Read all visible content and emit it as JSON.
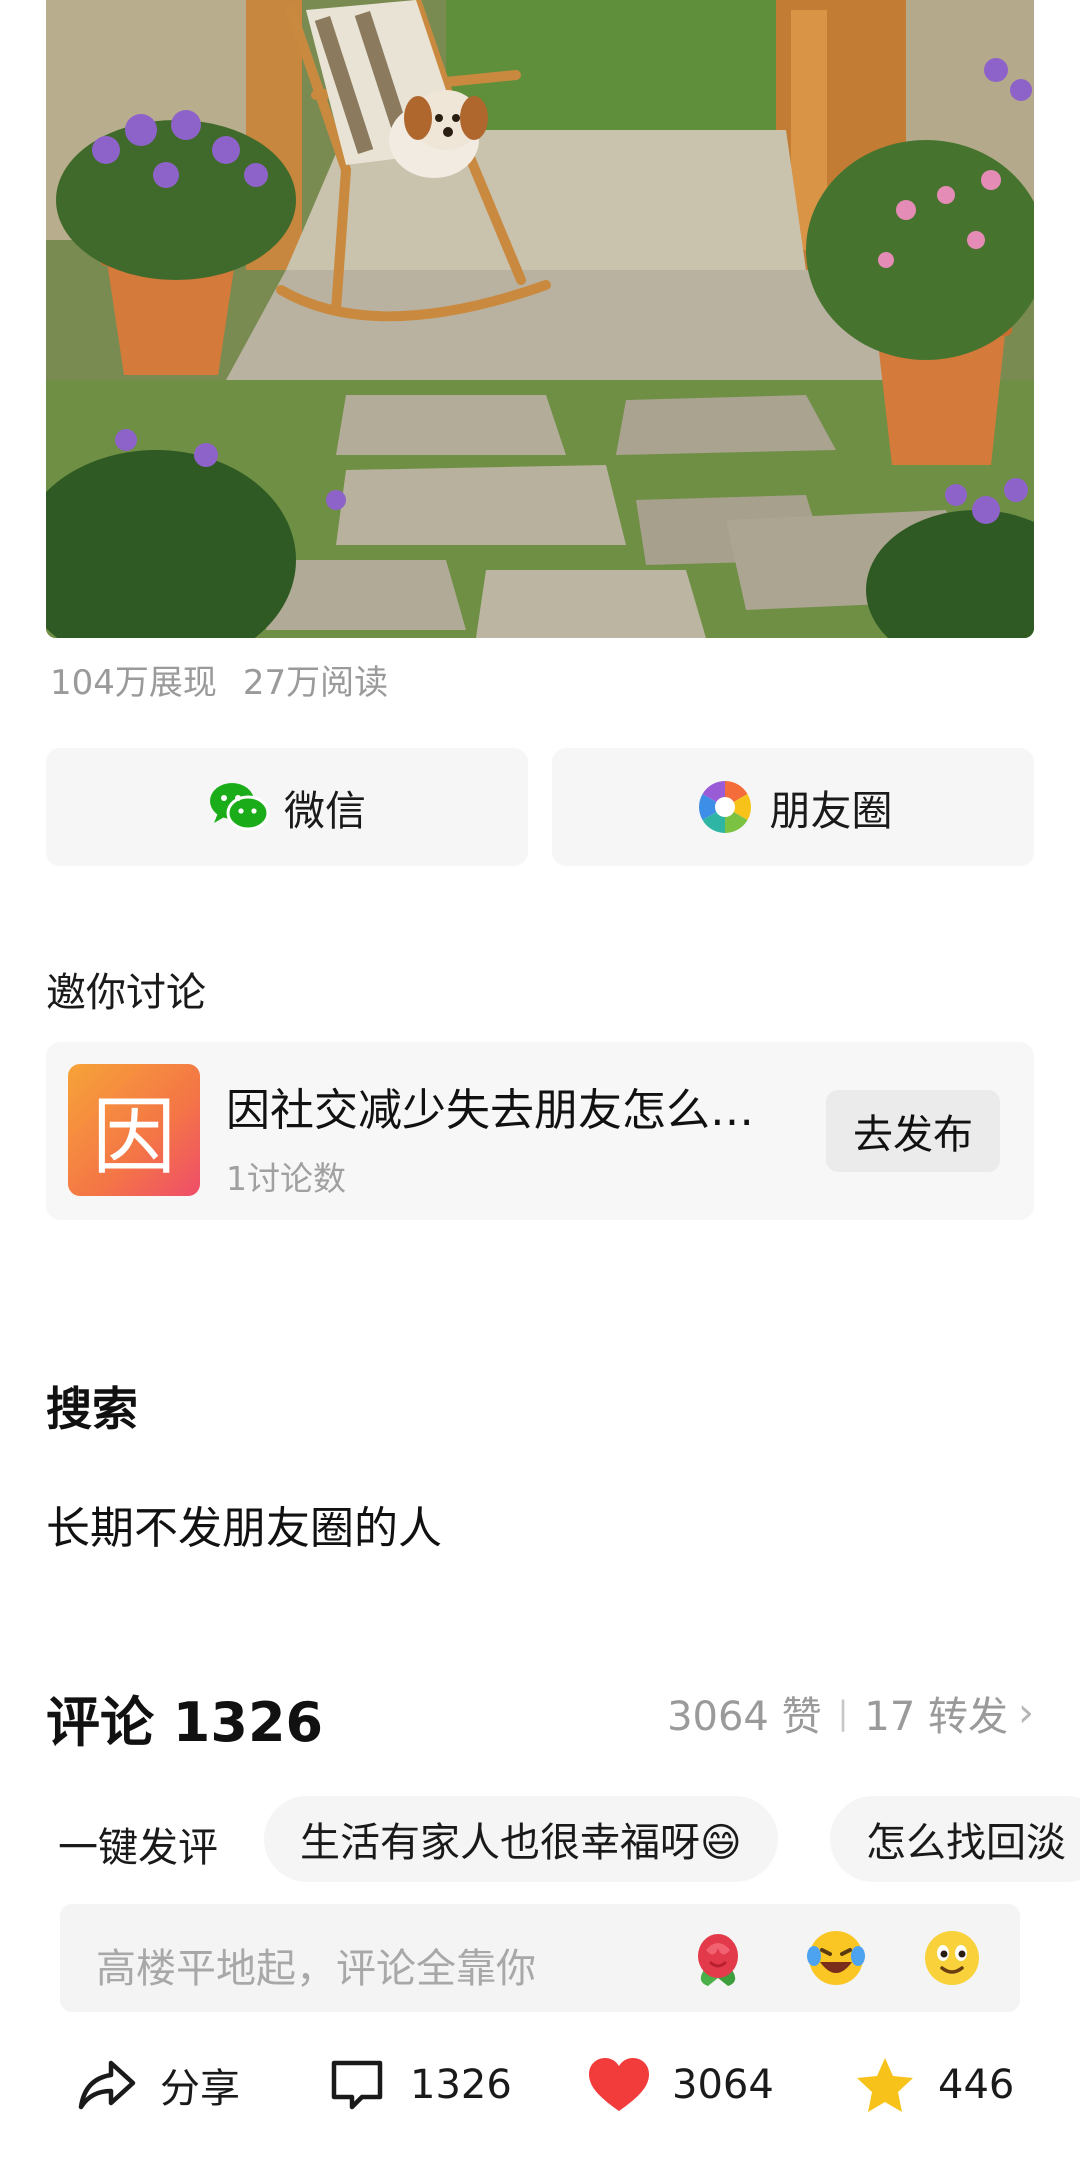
{
  "post": {
    "stats": {
      "views": "104万展现",
      "reads": "27万阅读"
    }
  },
  "share": {
    "wechat_label": "微信",
    "moments_label": "朋友圈"
  },
  "invite": {
    "label": "邀你讨论",
    "topic_title": "因社交减少失去朋友怎么…",
    "topic_glyph": "因",
    "topic_count": "1讨论数",
    "publish_button": "去发布"
  },
  "search": {
    "heading": "搜索",
    "query": "长期不发朋友圈的人"
  },
  "comments": {
    "heading": "评论 1326",
    "likes_text": "3064 赞",
    "reposts_text": "17 转发"
  },
  "quick_comment": {
    "label": "一键发评",
    "chips": [
      "生活有家人也很幸福呀😄",
      "怎么找回淡"
    ]
  },
  "comment_input": {
    "placeholder": "高楼平地起，评论全靠你",
    "emojis": [
      "rose-icon",
      "laughing-crying-icon",
      "smiling-face-icon"
    ]
  },
  "bottom_bar": {
    "share_label": "分享",
    "comment_count": "1326",
    "like_count": "3064",
    "favorite_count": "446"
  },
  "colors": {
    "wechat_green": "#1aad19",
    "like_red": "#f23b3b",
    "star_yellow": "#f7c21a",
    "topic_orange": "#f47546"
  }
}
